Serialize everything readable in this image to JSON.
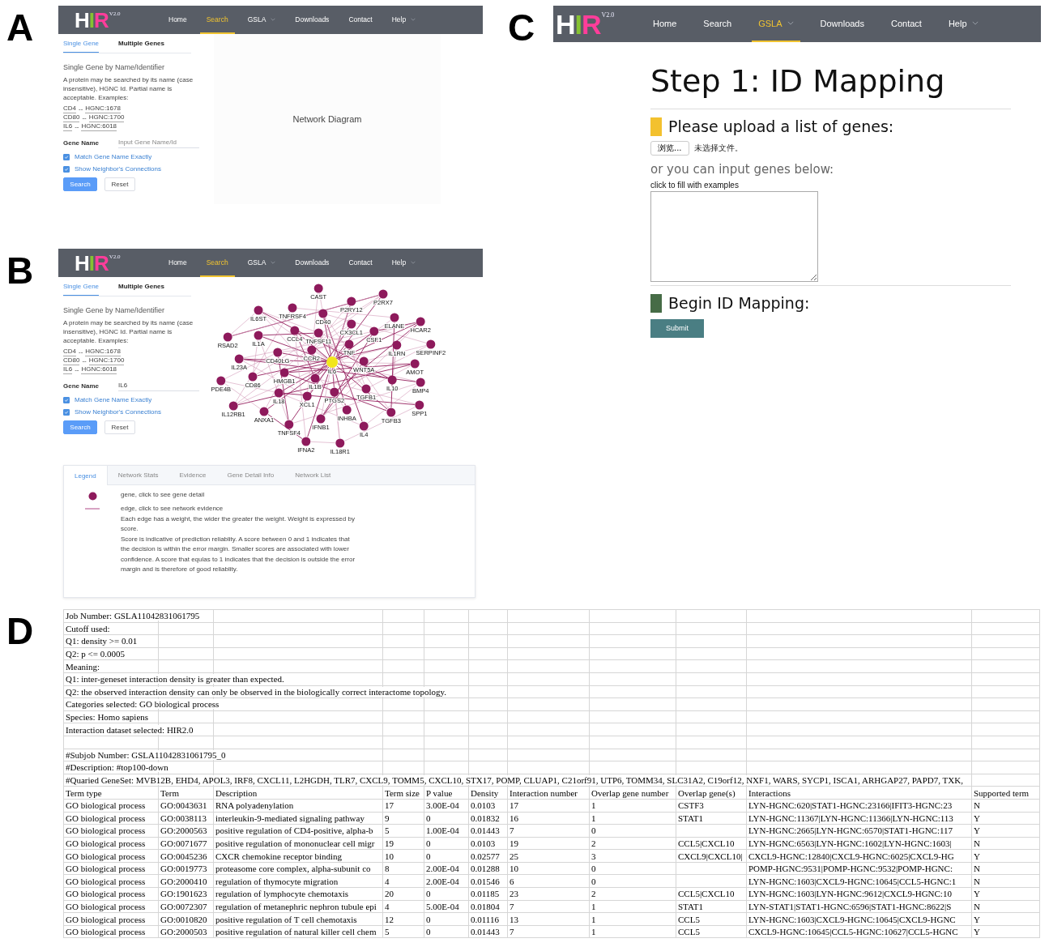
{
  "search_panels": [
    {
      "label": "A",
      "navbar": {
        "logo": "HIR",
        "version": "V2.0",
        "items": [
          {
            "label": "Home",
            "selected": false,
            "dropdown": false
          },
          {
            "label": "Search",
            "selected": true,
            "dropdown": false
          },
          {
            "label": "GSLA",
            "selected": false,
            "dropdown": true
          },
          {
            "label": "Downloads",
            "selected": false,
            "dropdown": false
          },
          {
            "label": "Contact",
            "selected": false,
            "dropdown": false
          },
          {
            "label": "Help",
            "selected": false,
            "dropdown": true
          }
        ]
      },
      "form": {
        "tabs": [
          {
            "label": "Single Gene",
            "selected": true
          },
          {
            "label": "Multiple Genes",
            "selected": false
          }
        ],
        "heading": "Single Gene by Name/Identifier",
        "description": "A protein may be searched by its name (case insensitive), HGNC Id. Partial name is acceptable. Examples:",
        "examples": [
          {
            "name": "CD4",
            "separator": "--",
            "id": "HGNC:1678"
          },
          {
            "name": "CD80",
            "separator": "--",
            "id": "HGNC:1700"
          },
          {
            "name": "IL6",
            "separator": "--",
            "id": "HGNC:6018"
          }
        ],
        "gene_field": {
          "label": "Gene Name",
          "placeholder": "Input Gene Name/Id"
        },
        "checkboxes": [
          {
            "label": "Match Gene Name Exactly",
            "checked": true
          },
          {
            "label": "Show Neighbor's Connections",
            "checked": true
          }
        ],
        "buttons": [
          {
            "label": "Search",
            "kind": "primary"
          },
          {
            "label": "Reset",
            "kind": "default"
          }
        ]
      },
      "network": {
        "kind": "placeholder",
        "text": "Network Diagram"
      }
    },
    {
      "label": "B",
      "navbar": {
        "logo": "HIR",
        "version": "V2.0",
        "items": [
          {
            "label": "Home",
            "selected": false,
            "dropdown": false
          },
          {
            "label": "Search",
            "selected": true,
            "dropdown": false
          },
          {
            "label": "GSLA",
            "selected": false,
            "dropdown": true
          },
          {
            "label": "Downloads",
            "selected": false,
            "dropdown": false
          },
          {
            "label": "Contact",
            "selected": false,
            "dropdown": false
          },
          {
            "label": "Help",
            "selected": false,
            "dropdown": true
          }
        ]
      },
      "form": {
        "tabs": [
          {
            "label": "Single Gene",
            "selected": true
          },
          {
            "label": "Multiple Genes",
            "selected": false
          }
        ],
        "heading": "Single Gene by Name/Identifier",
        "description": "A protein may be searched by its name (case insensitive), HGNC Id. Partial name is acceptable. Examples:",
        "examples": [
          {
            "name": "CD4",
            "separator": "--",
            "id": "HGNC:1678"
          },
          {
            "name": "CD80",
            "separator": "--",
            "id": "HGNC:1700"
          },
          {
            "name": "IL6",
            "separator": "--",
            "id": "HGNC:6018"
          }
        ],
        "gene_field": {
          "label": "Gene Name",
          "value": "IL6"
        },
        "checkboxes": [
          {
            "label": "Match Gene Name Exactly",
            "checked": true
          },
          {
            "label": "Show Neighbor's Connections",
            "checked": true
          }
        ],
        "buttons": [
          {
            "label": "Search",
            "kind": "primary"
          },
          {
            "label": "Reset",
            "kind": "default"
          }
        ]
      },
      "network": {
        "kind": "graph",
        "nodes": [
          {
            "label": "CAST",
            "selected": false
          },
          {
            "label": "P2RX7",
            "selected": false
          },
          {
            "label": "P2RY12",
            "selected": false
          },
          {
            "label": "IL6ST",
            "selected": false
          },
          {
            "label": "TNFRSF4",
            "selected": false
          },
          {
            "label": "CD40",
            "selected": false
          },
          {
            "label": "ELANE",
            "selected": false
          },
          {
            "label": "HCAR2",
            "selected": false
          },
          {
            "label": "CX3CL1",
            "selected": false
          },
          {
            "label": "CCL4",
            "selected": false
          },
          {
            "label": "TNFSF11",
            "selected": false
          },
          {
            "label": "CSF1",
            "selected": false
          },
          {
            "label": "RSAD2",
            "selected": false
          },
          {
            "label": "IL1A",
            "selected": false
          },
          {
            "label": "TNF",
            "selected": false
          },
          {
            "label": "IL1RN",
            "selected": false
          },
          {
            "label": "SERPINF2",
            "selected": false
          },
          {
            "label": "CD40LG",
            "selected": false
          },
          {
            "label": "CCR2",
            "selected": false
          },
          {
            "label": "IL6",
            "selected": true
          },
          {
            "label": "WNT5A",
            "selected": false
          },
          {
            "label": "AMOT",
            "selected": false
          },
          {
            "label": "IL23A",
            "selected": false
          },
          {
            "label": "HMGB1",
            "selected": false
          },
          {
            "label": "CD86",
            "selected": false
          },
          {
            "label": "IL1B",
            "selected": false
          },
          {
            "label": "IL10",
            "selected": false
          },
          {
            "label": "BMP4",
            "selected": false
          },
          {
            "label": "PDE4B",
            "selected": false
          },
          {
            "label": "IL18",
            "selected": false
          },
          {
            "label": "XCL1",
            "selected": false
          },
          {
            "label": "PTGS2",
            "selected": false
          },
          {
            "label": "TGFB1",
            "selected": false
          },
          {
            "label": "IL12RB1",
            "selected": false
          },
          {
            "label": "ANXA1",
            "selected": false
          },
          {
            "label": "INHBA",
            "selected": false
          },
          {
            "label": "SPP1",
            "selected": false
          },
          {
            "label": "TGFB3",
            "selected": false
          },
          {
            "label": "TNFSF4",
            "selected": false
          },
          {
            "label": "IFNB1",
            "selected": false
          },
          {
            "label": "IL4",
            "selected": false
          },
          {
            "label": "IFNA2",
            "selected": false
          },
          {
            "label": "IL18R1",
            "selected": false
          }
        ]
      },
      "details": {
        "tabs": [
          {
            "label": "Legend",
            "selected": true
          },
          {
            "label": "Network Stats",
            "selected": false
          },
          {
            "label": "Evidence",
            "selected": false
          },
          {
            "label": "Gene Detail Info",
            "selected": false
          },
          {
            "label": "Network List",
            "selected": false
          }
        ],
        "legend": [
          {
            "kind": "node",
            "texts": [
              "gene, click to see gene detail"
            ]
          },
          {
            "kind": "edge",
            "texts": [
              "edge, click to see network evidence",
              "Each edge has a weight, the wider the greater the weight. Weight is expressed by score.",
              "Score is indicative of prediction reliablity. A score between 0 and 1 indicates that the decision is within the error margin. Smaller scores are associated with lower confidence. A score that equlas to 1 indicates that the decision is outside the error margin and is therefore of good reliablity."
            ]
          }
        ]
      }
    }
  ],
  "mapping_panel": {
    "label": "C",
    "navbar": {
      "logo": "HIR",
      "version": "V2.0",
      "items": [
        {
          "label": "Home",
          "selected": false,
          "dropdown": false
        },
        {
          "label": "Search",
          "selected": false,
          "dropdown": false
        },
        {
          "label": "GSLA",
          "selected": true,
          "dropdown": true
        },
        {
          "label": "Downloads",
          "selected": false,
          "dropdown": false
        },
        {
          "label": "Contact",
          "selected": false,
          "dropdown": false
        },
        {
          "label": "Help",
          "selected": false,
          "dropdown": true
        }
      ]
    },
    "title": "Step 1: ID Mapping",
    "upload": {
      "heading": "Please upload a list of genes:",
      "color": "#f3c12e",
      "file_button": "浏览...",
      "file_status": "未选择文件。"
    },
    "input": {
      "heading": "or you can input genes below:",
      "example_link": "click to fill with examples"
    },
    "begin": {
      "heading": "Begin ID Mapping:",
      "color": "#466c46",
      "button": "Submit"
    }
  },
  "results_panel": {
    "label": "D",
    "info_rows": [
      "Job Number: GSLA11042831061795",
      "Cutoff used:",
      "Q1: density >= 0.01",
      "Q2: p <= 0.0005",
      "Meaning:",
      "Q1: inter-geneset interaction density is greater than expected.",
      "Q2: the observed interaction density can only be observed in the biologically correct interactome topology.",
      "Categories selected: GO biological process",
      "Species: Homo sapiens",
      "Interaction dataset selected: HIR2.0"
    ],
    "subjob_rows": [
      "#Subjob Number: GSLA11042831061795_0",
      "#Description: #top100-down",
      "#Quaried GeneSet: MVB12B, EHD4, APOL3, IRF8, CXCL11, L2HGDH, TLR7, CXCL9, TOMM5, CXCL10, STX17, POMP, CLUAP1, C21orf91, UTP6, TOMM34, SLC31A2, C19orf12, NXF1, WARS, SYCP1, ISCA1, ARHGAP27, PAPD7, TXK,"
    ],
    "columns": [
      "Term type",
      "Term",
      "Description",
      "Term size",
      "P value",
      "Density",
      "Interaction number",
      "Overlap gene number",
      "Overlap gene(s)",
      "Interactions",
      "Supported term"
    ],
    "rows": [
      {
        "term_type": "GO biological process",
        "term": "GO:0043631",
        "description": "RNA polyadenylation",
        "term_size": "17",
        "p_value": "3.00E-04",
        "density": "0.0103",
        "interaction_number": "17",
        "overlap_gene_number": "1",
        "overlap_genes": "CSTF3",
        "interactions": "LYN-HGNC:620|STAT1-HGNC:23166|IFIT3-HGNC:23",
        "supported_term": "N"
      },
      {
        "term_type": "GO biological process",
        "term": "GO:0038113",
        "description": "interleukin-9-mediated signaling pathway",
        "term_size": "9",
        "p_value": "0",
        "density": "0.01832",
        "interaction_number": "16",
        "overlap_gene_number": "1",
        "overlap_genes": "STAT1",
        "interactions": "LYN-HGNC:11367|LYN-HGNC:11366|LYN-HGNC:113",
        "supported_term": "Y"
      },
      {
        "term_type": "GO biological process",
        "term": "GO:2000563",
        "description": "positive regulation of CD4-positive, alpha-b",
        "term_size": "5",
        "p_value": "1.00E-04",
        "density": "0.01443",
        "interaction_number": "7",
        "overlap_gene_number": "0",
        "interactions": "LYN-HGNC:2665|LYN-HGNC:6570|STAT1-HGNC:117",
        "supported_term": "Y"
      },
      {
        "term_type": "GO biological process",
        "term": "GO:0071677",
        "description": "positive regulation of mononuclear cell migr",
        "term_size": "19",
        "p_value": "0",
        "density": "0.0103",
        "interaction_number": "19",
        "overlap_gene_number": "2",
        "overlap_genes": "CCL5|CXCL10",
        "interactions": "LYN-HGNC:6563|LYN-HGNC:1602|LYN-HGNC:1603|",
        "supported_term": "N"
      },
      {
        "term_type": "GO biological process",
        "term": "GO:0045236",
        "description": "CXCR chemokine receptor binding",
        "term_size": "10",
        "p_value": "0",
        "density": "0.02577",
        "interaction_number": "25",
        "overlap_gene_number": "3",
        "overlap_genes": "CXCL9|CXCL10|",
        "interactions": "CXCL9-HGNC:12840|CXCL9-HGNC:6025|CXCL9-HG",
        "supported_term": "Y"
      },
      {
        "term_type": "GO biological process",
        "term": "GO:0019773",
        "description": "proteasome core complex, alpha-subunit co",
        "term_size": "8",
        "p_value": "2.00E-04",
        "density": "0.01288",
        "interaction_number": "10",
        "overlap_gene_number": "0",
        "interactions": "POMP-HGNC:9531|POMP-HGNC:9532|POMP-HGNC:",
        "supported_term": "N"
      },
      {
        "term_type": "GO biological process",
        "term": "GO:2000410",
        "description": "regulation of thymocyte migration",
        "term_size": "4",
        "p_value": "2.00E-04",
        "density": "0.01546",
        "interaction_number": "6",
        "overlap_gene_number": "0",
        "interactions": "LYN-HGNC:1603|CXCL9-HGNC:10645|CCL5-HGNC:1",
        "supported_term": "N"
      },
      {
        "term_type": "GO biological process",
        "term": "GO:1901623",
        "description": "regulation of lymphocyte chemotaxis",
        "term_size": "20",
        "p_value": "0",
        "density": "0.01185",
        "interaction_number": "23",
        "overlap_gene_number": "2",
        "overlap_genes": "CCL5|CXCL10",
        "interactions": "LYN-HGNC:1603|LYN-HGNC:9612|CXCL9-HGNC:10",
        "supported_term": "Y"
      },
      {
        "term_type": "GO biological process",
        "term": "GO:0072307",
        "description": "regulation of metanephric nephron tubule epi",
        "term_size": "4",
        "p_value": "5.00E-04",
        "density": "0.01804",
        "interaction_number": "7",
        "overlap_gene_number": "1",
        "overlap_genes": "STAT1",
        "interactions": "LYN-STAT1|STAT1-HGNC:6596|STAT1-HGNC:8622|S",
        "supported_term": "N"
      },
      {
        "term_type": "GO biological process",
        "term": "GO:0010820",
        "description": "positive regulation of T cell chemotaxis",
        "term_size": "12",
        "p_value": "0",
        "density": "0.01116",
        "interaction_number": "13",
        "overlap_gene_number": "1",
        "overlap_genes": "CCL5",
        "interactions": "LYN-HGNC:1603|CXCL9-HGNC:10645|CXCL9-HGNC",
        "supported_term": "Y"
      },
      {
        "term_type": "GO biological process",
        "term": "GO:2000503",
        "description": "positive regulation of natural killer cell chem",
        "term_size": "5",
        "p_value": "0",
        "density": "0.01443",
        "interaction_number": "7",
        "overlap_gene_number": "1",
        "overlap_genes": "CCL5",
        "interactions": "CXCL9-HGNC:10645|CCL5-HGNC:10627|CCL5-HGNC",
        "supported_term": "Y"
      }
    ]
  }
}
